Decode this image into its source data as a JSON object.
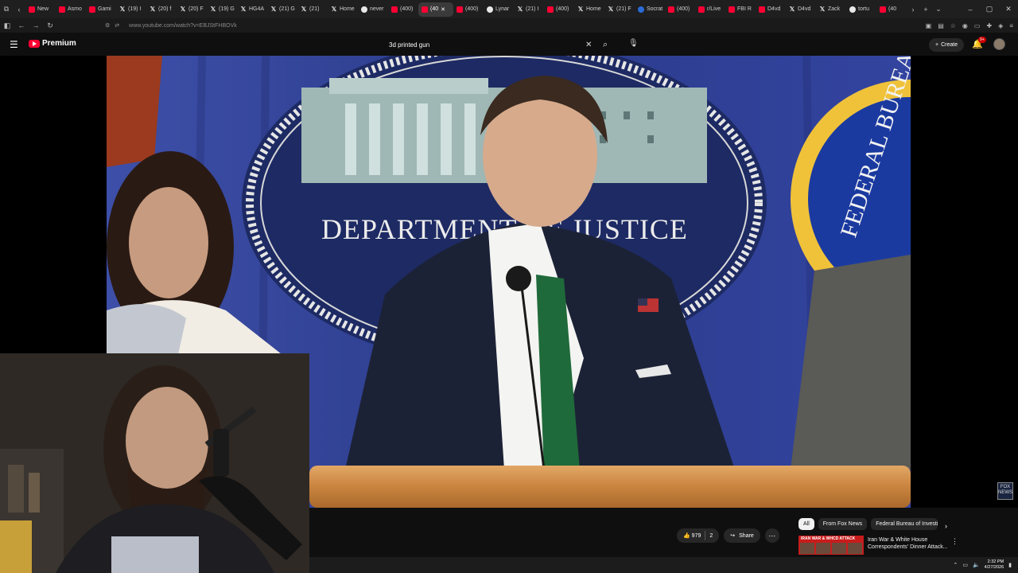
{
  "browser": {
    "tabs": [
      {
        "label": "New",
        "icon": "yt"
      },
      {
        "label": "Asmo",
        "icon": "yt"
      },
      {
        "label": "Gami",
        "icon": "yt"
      },
      {
        "label": "(19) I",
        "icon": "x"
      },
      {
        "label": "(20) f",
        "icon": "x"
      },
      {
        "label": "(20) F",
        "icon": "x"
      },
      {
        "label": "(19) G",
        "icon": "x"
      },
      {
        "label": "HG4A",
        "icon": "x"
      },
      {
        "label": "(21) G",
        "icon": "x"
      },
      {
        "label": "(21)",
        "icon": "x"
      },
      {
        "label": "Home",
        "icon": "x"
      },
      {
        "label": "never",
        "icon": "g"
      },
      {
        "label": "(400)",
        "icon": "yt"
      },
      {
        "label": "(40",
        "icon": "yt",
        "active": true
      },
      {
        "label": "(400)",
        "icon": "yt"
      },
      {
        "label": "Lynar",
        "icon": "g"
      },
      {
        "label": "(21) I",
        "icon": "x"
      },
      {
        "label": "(400)",
        "icon": "yt"
      },
      {
        "label": "Home",
        "icon": "x"
      },
      {
        "label": "(21) F",
        "icon": "x"
      },
      {
        "label": "Socrat",
        "icon": "sub"
      },
      {
        "label": "(400)",
        "icon": "yt"
      },
      {
        "label": "r/Live",
        "icon": "yt"
      },
      {
        "label": "FBI R",
        "icon": "yt"
      },
      {
        "label": "D4vd",
        "icon": "yt"
      },
      {
        "label": "D4vd",
        "icon": "x"
      },
      {
        "label": "Zack",
        "icon": "x"
      },
      {
        "label": "tortu",
        "icon": "g"
      },
      {
        "label": "(40",
        "icon": "yt"
      }
    ],
    "url": "www.youtube.com/watch?v=EBJStFHBOVk"
  },
  "youtube": {
    "brand": "Premium",
    "search_value": "3d printed gun",
    "create_label": "Create",
    "notif_count": "9+"
  },
  "video": {
    "seal_text": "DEPARTMENT OF JUSTICE",
    "side_seal_text": "FEDERAL BUREAU",
    "network_watermark": "FOX NEWS"
  },
  "actions": {
    "like_count": "979",
    "comment_count": "2",
    "share_label": "Share"
  },
  "chips": [
    "All",
    "From Fox News",
    "Federal Bureau of Investigation"
  ],
  "recommendation": {
    "thumb_label": "IRAN WAR & WHCD ATTACK",
    "title": "Iran War & White House Correspondents' Dinner Attack..."
  },
  "taskbar": {
    "time": "2:32 PM",
    "date": "4/27/2026"
  }
}
